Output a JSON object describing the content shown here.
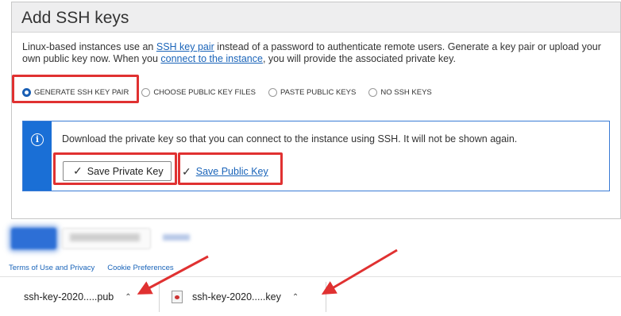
{
  "panel": {
    "title": "Add SSH keys",
    "description": {
      "part1": "Linux-based instances use an ",
      "link1": "SSH key pair",
      "part2": " instead of a password to authenticate remote users. Generate a key pair or upload your own public key now. When you ",
      "link2": "connect to the instance",
      "part3": ", you will provide the associated private key."
    },
    "radios": [
      {
        "label": "GENERATE SSH KEY PAIR",
        "checked": true
      },
      {
        "label": "CHOOSE PUBLIC KEY FILES",
        "checked": false
      },
      {
        "label": "PASTE PUBLIC KEYS",
        "checked": false
      },
      {
        "label": "NO SSH KEYS",
        "checked": false
      }
    ],
    "info": {
      "icon": "info-icon",
      "message": "Download the private key so that you can connect to the instance using SSH. It will not be shown again.",
      "save_private_label": "Save Private Key",
      "save_public_label": "Save Public Key"
    }
  },
  "footer": {
    "links": [
      "Terms of Use and Privacy",
      "Cookie Preferences"
    ]
  },
  "downloads": [
    {
      "filename": "ssh-key-2020.....pub",
      "icon": "file-icon"
    },
    {
      "filename": "ssh-key-2020.....key",
      "icon": "certificate-file-icon"
    }
  ],
  "colors": {
    "accent": "#1a6fd6",
    "link": "#1a64b9",
    "highlight": "#e03131"
  }
}
